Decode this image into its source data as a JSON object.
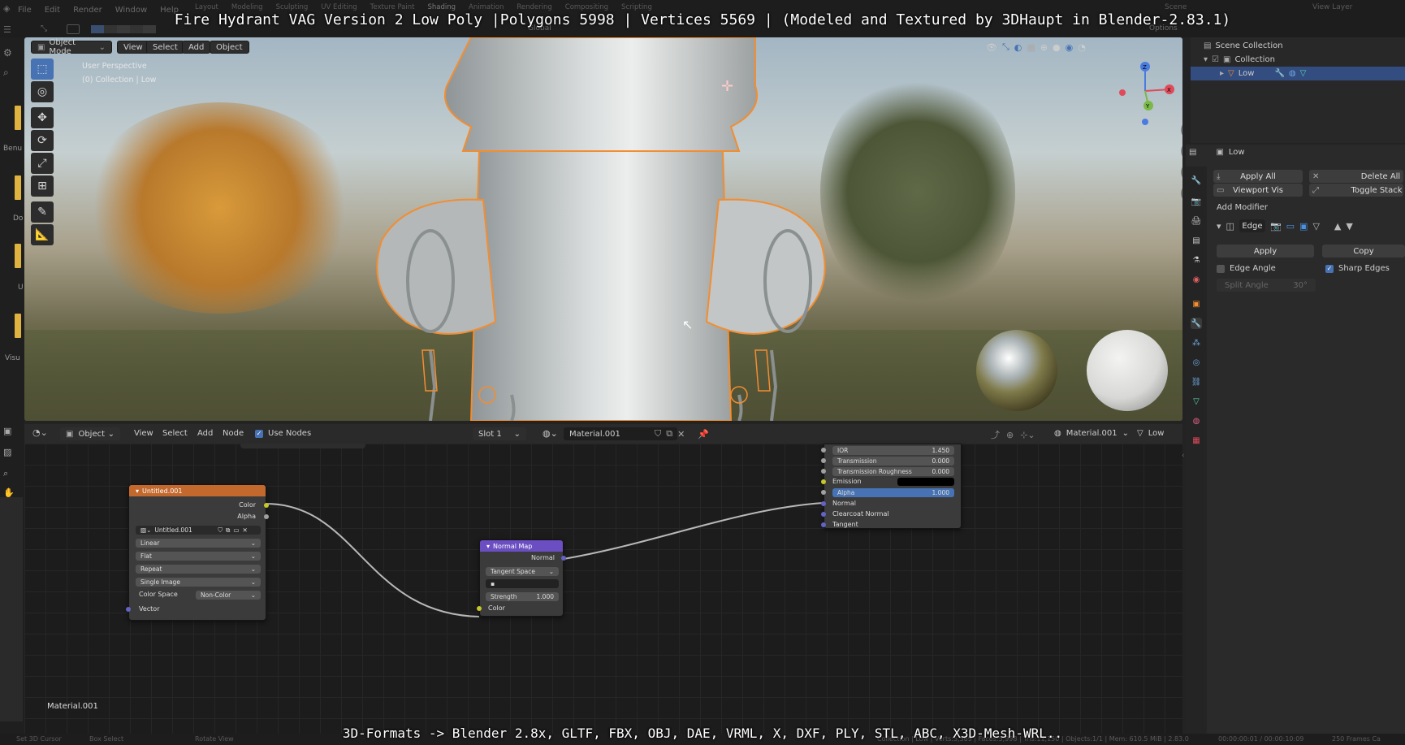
{
  "overlay": {
    "title": "Fire Hydrant VAG Version 2 Low Poly |Polygons 5998 | Vertices 5569 | (Modeled and Textured by 3DHaupt in Blender-2.83.1)",
    "bottom": "3D-Formats -> Blender 2.8x, GLTF, FBX, OBJ, DAE, VRML, X, DXF, PLY, STL, ABC, X3D-Mesh-WRL.."
  },
  "topbar": {
    "menus": [
      "File",
      "Edit",
      "Render",
      "Window",
      "Help"
    ],
    "tabs": [
      "Layout",
      "Modeling",
      "Sculpting",
      "UV Editing",
      "Texture Paint",
      "Shading",
      "Animation",
      "Rendering",
      "Compositing",
      "Scripting"
    ],
    "scene": "Scene",
    "view_layer": "View Layer"
  },
  "viewport": {
    "mode": "Object Mode",
    "menus": [
      "View",
      "Select",
      "Add",
      "Object"
    ],
    "transform": "Global",
    "options": "Options",
    "info_line1": "User Perspective",
    "info_line2": "(0) Collection | Low",
    "gizmo_x": "X",
    "gizmo_y": "Y",
    "gizmo_z": "Z"
  },
  "left_strip": {
    "labels": [
      "Benu",
      "Do",
      "U",
      "Visu"
    ]
  },
  "outliner": {
    "scene_collection": "Scene Collection",
    "collection": "Collection",
    "object": "Low"
  },
  "properties": {
    "object_name": "Low",
    "apply_all": "Apply All",
    "delete_all": "Delete All",
    "viewport_vis": "Viewport Vis",
    "toggle_stack": "Toggle Stack",
    "add_modifier": "Add Modifier",
    "modifier_name": "Edge",
    "apply": "Apply",
    "copy": "Copy",
    "edge_angle": "Edge Angle",
    "sharp_edges": "Sharp Edges",
    "split_angle_label": "Split Angle",
    "split_angle_value": "30°"
  },
  "node_header": {
    "editor": "Object",
    "menus": [
      "View",
      "Select",
      "Add",
      "Node"
    ],
    "use_nodes": "Use Nodes",
    "slot": "Slot 1",
    "material": "Material.001",
    "material_right": "Material.001",
    "object": "Low"
  },
  "nodes": {
    "image": {
      "title": "Untitled.001",
      "out_color": "Color",
      "out_alpha": "Alpha",
      "image_name": "Untitled.001",
      "interp": "Linear",
      "projection": "Flat",
      "extension": "Repeat",
      "source": "Single Image",
      "colorspace_label": "Color Space",
      "colorspace": "Non-Color",
      "vector": "Vector"
    },
    "normal_map": {
      "title": "Normal Map",
      "out_normal": "Normal",
      "space": "Tangent Space",
      "strength_label": "Strength",
      "strength": "1.000",
      "in_color": "Color"
    },
    "bsdf": {
      "rows": [
        {
          "label": "IOR",
          "value": "1.450"
        },
        {
          "label": "Transmission",
          "value": "0.000"
        },
        {
          "label": "Transmission Roughness",
          "value": "0.000"
        }
      ],
      "emission": "Emission",
      "alpha_label": "Alpha",
      "alpha_value": "1.000",
      "normal": "Normal",
      "clearcoat_normal": "Clearcoat Normal",
      "tangent": "Tangent"
    },
    "material_label": "Material.001"
  },
  "statusbar": {
    "left": "Set 3D Cursor",
    "box": "Box Select",
    "rotate": "Rotate View",
    "right": "Collection | Low | Verts:5,569 | Faces:5,998 | Tris:11,150 | Objects:1/1 | Mem: 610.5 MiB | 2.83.0",
    "time": "00:00:00:01 / 00:00:10:09",
    "frames": "250 Frames Ca"
  },
  "colors": {
    "accent_blue": "#4772b3",
    "selection_orange": "#f28d31",
    "image_node": "#c4692e",
    "normal_map_node": "#6a4ec2"
  }
}
